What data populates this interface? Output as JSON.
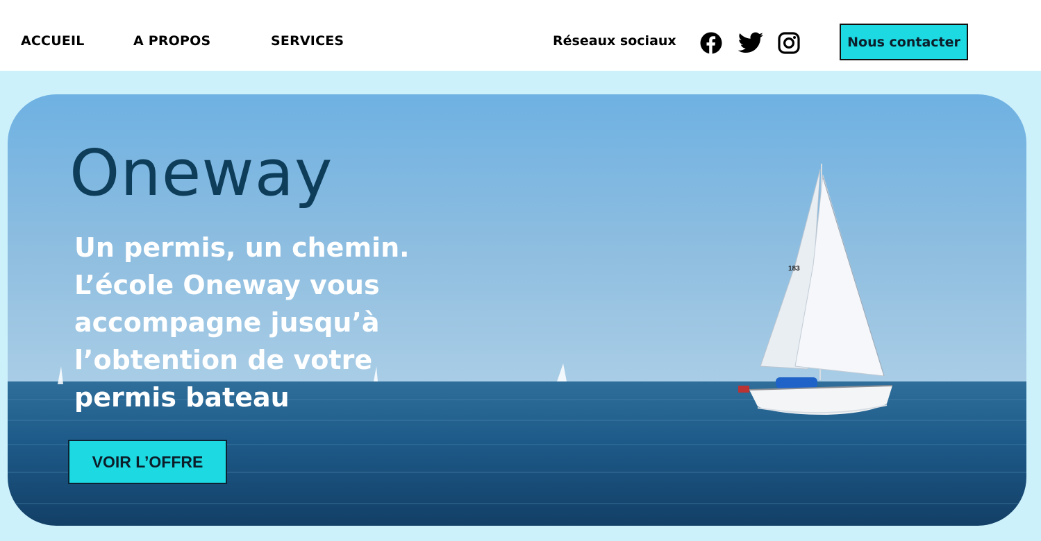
{
  "nav": {
    "items": [
      {
        "label": "ACCUEIL"
      },
      {
        "label": "A PROPOS"
      },
      {
        "label": "SERVICES"
      }
    ],
    "social_label": "Réseaux sociaux",
    "social_icons": [
      "facebook-icon",
      "twitter-icon",
      "instagram-icon"
    ],
    "contact_label": "Nous contacter"
  },
  "hero": {
    "title": "Oneway",
    "tagline_lines": [
      "Un permis, un chemin.",
      "L’école Oneway vous",
      "accompagne jusqu’à",
      "l’obtention de votre",
      "permis bateau"
    ],
    "cta_label": "VOIR L’OFFRE",
    "sail_number": "183"
  },
  "colors": {
    "accent": "#1dd9e2",
    "page_background": "#cdf1fb",
    "title": "#0e3d5a",
    "sky_top": "#74b3e2",
    "sea": "#1e5b8a"
  }
}
